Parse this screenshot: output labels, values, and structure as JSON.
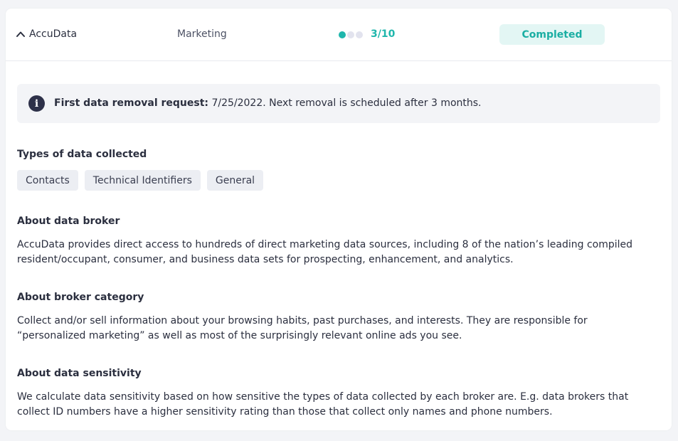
{
  "broker": {
    "name": "AccuData",
    "category": "Marketing",
    "sensitivity": {
      "label": "3/10",
      "level": 1,
      "total_dots": 3
    },
    "status": "Completed"
  },
  "info": {
    "label": "First data removal request:",
    "text": " 7/25/2022. Next removal is scheduled after 3 months."
  },
  "data_types": {
    "title": "Types of data collected",
    "tags": [
      "Contacts",
      "Technical Identifiers",
      "General"
    ]
  },
  "about_broker": {
    "title": "About data broker",
    "text": "AccuData provides direct access to hundreds of direct marketing data sources, including 8 of the nation’s leading compiled resident/occupant, consumer, and business data sets for prospecting, enhancement, and analytics."
  },
  "about_category": {
    "title": "About broker category",
    "text": "Collect and/or sell information about your browsing habits, past purchases, and interests. They are responsible for “personalized marketing” as well as most of the surprisingly relevant online ads you see."
  },
  "about_sensitivity": {
    "title": "About data sensitivity",
    "text": "We calculate data sensitivity based on how sensitive the types of data collected by each broker are. E.g. data brokers that collect ID numbers have a higher sensitivity rating than those that collect only names and phone numbers."
  },
  "colors": {
    "accent": "#1fb6ac",
    "dot_inactive": "#e2e3ee",
    "badge_bg": "#e3f6f4"
  },
  "icons": {
    "collapse": "chevron-up-icon",
    "info": "info-icon"
  }
}
